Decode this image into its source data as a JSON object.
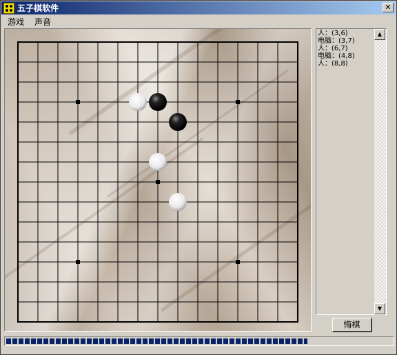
{
  "window": {
    "title": "五子棋软件",
    "close_label": "✕"
  },
  "menu": {
    "items": [
      {
        "label": "游戏"
      },
      {
        "label": "声音"
      }
    ]
  },
  "board": {
    "grid_size": 15,
    "star_points": [
      [
        3,
        3
      ],
      [
        11,
        3
      ],
      [
        7,
        7
      ],
      [
        3,
        11
      ],
      [
        11,
        11
      ]
    ],
    "stones": [
      {
        "col": 6,
        "row": 3,
        "color": "white"
      },
      {
        "col": 7,
        "row": 3,
        "color": "black"
      },
      {
        "col": 8,
        "row": 4,
        "color": "black"
      },
      {
        "col": 7,
        "row": 6,
        "color": "white"
      },
      {
        "col": 8,
        "row": 8,
        "color": "white"
      }
    ]
  },
  "move_log": {
    "entries": [
      "人：(3,6)",
      "电脑：(3,7)",
      "人：(6,7)",
      "电脑：(4,8)",
      "人：(8,8)"
    ]
  },
  "scroll": {
    "up_icon": "▲",
    "down_icon": "▼"
  },
  "buttons": {
    "undo_label": "悔棋"
  },
  "progress": {
    "fraction": 0.78
  },
  "colors": {
    "title_start": "#0a246a",
    "progress": "#0a246a"
  }
}
